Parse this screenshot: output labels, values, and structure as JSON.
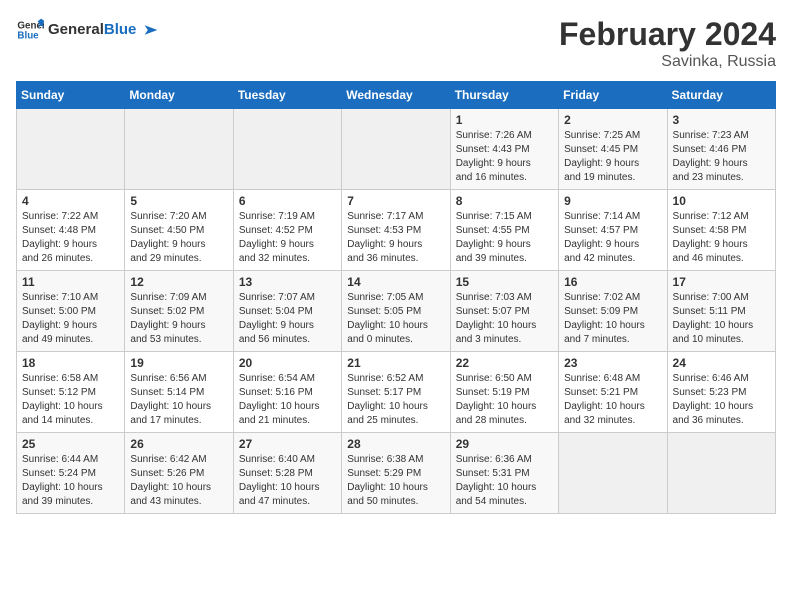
{
  "header": {
    "logo_line1": "General",
    "logo_line2": "Blue",
    "title": "February 2024",
    "subtitle": "Savinka, Russia"
  },
  "days_of_week": [
    "Sunday",
    "Monday",
    "Tuesday",
    "Wednesday",
    "Thursday",
    "Friday",
    "Saturday"
  ],
  "weeks": [
    [
      {
        "day": "",
        "info": ""
      },
      {
        "day": "",
        "info": ""
      },
      {
        "day": "",
        "info": ""
      },
      {
        "day": "",
        "info": ""
      },
      {
        "day": "1",
        "info": "Sunrise: 7:26 AM\nSunset: 4:43 PM\nDaylight: 9 hours\nand 16 minutes."
      },
      {
        "day": "2",
        "info": "Sunrise: 7:25 AM\nSunset: 4:45 PM\nDaylight: 9 hours\nand 19 minutes."
      },
      {
        "day": "3",
        "info": "Sunrise: 7:23 AM\nSunset: 4:46 PM\nDaylight: 9 hours\nand 23 minutes."
      }
    ],
    [
      {
        "day": "4",
        "info": "Sunrise: 7:22 AM\nSunset: 4:48 PM\nDaylight: 9 hours\nand 26 minutes."
      },
      {
        "day": "5",
        "info": "Sunrise: 7:20 AM\nSunset: 4:50 PM\nDaylight: 9 hours\nand 29 minutes."
      },
      {
        "day": "6",
        "info": "Sunrise: 7:19 AM\nSunset: 4:52 PM\nDaylight: 9 hours\nand 32 minutes."
      },
      {
        "day": "7",
        "info": "Sunrise: 7:17 AM\nSunset: 4:53 PM\nDaylight: 9 hours\nand 36 minutes."
      },
      {
        "day": "8",
        "info": "Sunrise: 7:15 AM\nSunset: 4:55 PM\nDaylight: 9 hours\nand 39 minutes."
      },
      {
        "day": "9",
        "info": "Sunrise: 7:14 AM\nSunset: 4:57 PM\nDaylight: 9 hours\nand 42 minutes."
      },
      {
        "day": "10",
        "info": "Sunrise: 7:12 AM\nSunset: 4:58 PM\nDaylight: 9 hours\nand 46 minutes."
      }
    ],
    [
      {
        "day": "11",
        "info": "Sunrise: 7:10 AM\nSunset: 5:00 PM\nDaylight: 9 hours\nand 49 minutes."
      },
      {
        "day": "12",
        "info": "Sunrise: 7:09 AM\nSunset: 5:02 PM\nDaylight: 9 hours\nand 53 minutes."
      },
      {
        "day": "13",
        "info": "Sunrise: 7:07 AM\nSunset: 5:04 PM\nDaylight: 9 hours\nand 56 minutes."
      },
      {
        "day": "14",
        "info": "Sunrise: 7:05 AM\nSunset: 5:05 PM\nDaylight: 10 hours\nand 0 minutes."
      },
      {
        "day": "15",
        "info": "Sunrise: 7:03 AM\nSunset: 5:07 PM\nDaylight: 10 hours\nand 3 minutes."
      },
      {
        "day": "16",
        "info": "Sunrise: 7:02 AM\nSunset: 5:09 PM\nDaylight: 10 hours\nand 7 minutes."
      },
      {
        "day": "17",
        "info": "Sunrise: 7:00 AM\nSunset: 5:11 PM\nDaylight: 10 hours\nand 10 minutes."
      }
    ],
    [
      {
        "day": "18",
        "info": "Sunrise: 6:58 AM\nSunset: 5:12 PM\nDaylight: 10 hours\nand 14 minutes."
      },
      {
        "day": "19",
        "info": "Sunrise: 6:56 AM\nSunset: 5:14 PM\nDaylight: 10 hours\nand 17 minutes."
      },
      {
        "day": "20",
        "info": "Sunrise: 6:54 AM\nSunset: 5:16 PM\nDaylight: 10 hours\nand 21 minutes."
      },
      {
        "day": "21",
        "info": "Sunrise: 6:52 AM\nSunset: 5:17 PM\nDaylight: 10 hours\nand 25 minutes."
      },
      {
        "day": "22",
        "info": "Sunrise: 6:50 AM\nSunset: 5:19 PM\nDaylight: 10 hours\nand 28 minutes."
      },
      {
        "day": "23",
        "info": "Sunrise: 6:48 AM\nSunset: 5:21 PM\nDaylight: 10 hours\nand 32 minutes."
      },
      {
        "day": "24",
        "info": "Sunrise: 6:46 AM\nSunset: 5:23 PM\nDaylight: 10 hours\nand 36 minutes."
      }
    ],
    [
      {
        "day": "25",
        "info": "Sunrise: 6:44 AM\nSunset: 5:24 PM\nDaylight: 10 hours\nand 39 minutes."
      },
      {
        "day": "26",
        "info": "Sunrise: 6:42 AM\nSunset: 5:26 PM\nDaylight: 10 hours\nand 43 minutes."
      },
      {
        "day": "27",
        "info": "Sunrise: 6:40 AM\nSunset: 5:28 PM\nDaylight: 10 hours\nand 47 minutes."
      },
      {
        "day": "28",
        "info": "Sunrise: 6:38 AM\nSunset: 5:29 PM\nDaylight: 10 hours\nand 50 minutes."
      },
      {
        "day": "29",
        "info": "Sunrise: 6:36 AM\nSunset: 5:31 PM\nDaylight: 10 hours\nand 54 minutes."
      },
      {
        "day": "",
        "info": ""
      },
      {
        "day": "",
        "info": ""
      }
    ]
  ]
}
